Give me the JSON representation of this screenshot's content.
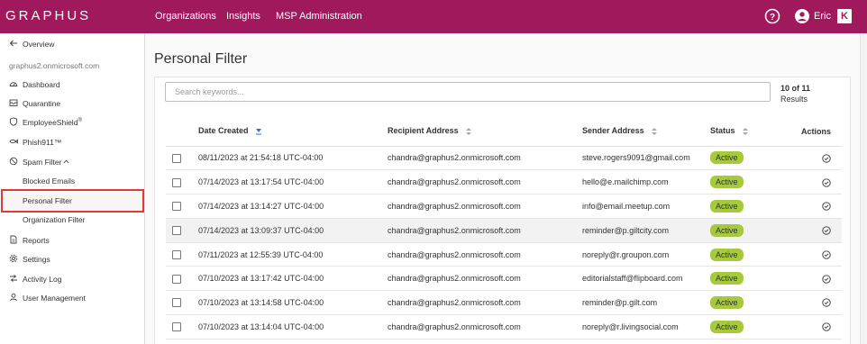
{
  "app": {
    "logo_text": "GRAPHUS"
  },
  "topnav": {
    "items": [
      "Organizations",
      "Insights",
      "MSP Administration"
    ]
  },
  "user": {
    "name": "Eric",
    "k_badge": "K"
  },
  "sidebar": {
    "overview_label": "Overview",
    "tenant": "graphus2.onmicrosoft.com",
    "items": {
      "dashboard": "Dashboard",
      "quarantine": "Quarantine",
      "employeeshield": "EmployeeShield",
      "employeeshield_mark": "®",
      "phish911": "Phish911™",
      "spam_filter": "Spam Filter",
      "blocked_emails": "Blocked Emails",
      "personal_filter": "Personal Filter",
      "organization_filter": "Organization Filter",
      "reports": "Reports",
      "settings": "Settings",
      "activity_log": "Activity Log",
      "user_management": "User Management"
    }
  },
  "main": {
    "title": "Personal Filter",
    "search_placeholder": "Search keywords...",
    "count_main": "10 of 11",
    "count_sub": "Results",
    "columns": {
      "date": "Date Created",
      "recipient": "Recipient Address",
      "sender": "Sender Address",
      "status": "Status",
      "actions": "Actions"
    },
    "rows": [
      {
        "date": "08/11/2023 at 21:54:18 UTC-04:00",
        "recipient": "chandra@graphus2.onmicrosoft.com",
        "sender": "steve.rogers9091@gmail.com",
        "status": "Active"
      },
      {
        "date": "07/14/2023 at 13:17:54 UTC-04:00",
        "recipient": "chandra@graphus2.onmicrosoft.com",
        "sender": "hello@e.mailchimp.com",
        "status": "Active"
      },
      {
        "date": "07/14/2023 at 13:14:27 UTC-04:00",
        "recipient": "chandra@graphus2.onmicrosoft.com",
        "sender": "info@email.meetup.com",
        "status": "Active"
      },
      {
        "date": "07/14/2023 at 13:09:37 UTC-04:00",
        "recipient": "chandra@graphus2.onmicrosoft.com",
        "sender": "reminder@p.giltcity.com",
        "status": "Active"
      },
      {
        "date": "07/11/2023 at 12:55:39 UTC-04:00",
        "recipient": "chandra@graphus2.onmicrosoft.com",
        "sender": "noreply@r.groupon.com",
        "status": "Active"
      },
      {
        "date": "07/10/2023 at 13:17:42 UTC-04:00",
        "recipient": "chandra@graphus2.onmicrosoft.com",
        "sender": "editorialstaff@flipboard.com",
        "status": "Active"
      },
      {
        "date": "07/10/2023 at 13:14:58 UTC-04:00",
        "recipient": "chandra@graphus2.onmicrosoft.com",
        "sender": "reminder@p.gilt.com",
        "status": "Active"
      },
      {
        "date": "07/10/2023 at 13:14:04 UTC-04:00",
        "recipient": "chandra@graphus2.onmicrosoft.com",
        "sender": "noreply@r.livingsocial.com",
        "status": "Active"
      }
    ]
  },
  "colors": {
    "brand": "#a0195c",
    "active_badge": "#a6c93d",
    "highlight": "#e23a3a"
  },
  "icons": [
    "help-icon",
    "user-avatar-icon",
    "k-app-icon",
    "arrow-left-icon",
    "dashboard-icon",
    "quarantine-icon",
    "shield-icon",
    "phish-icon",
    "spam-filter-icon",
    "chevron-up-icon",
    "reports-icon",
    "settings-icon",
    "activity-log-icon",
    "user-management-icon",
    "sort-icon",
    "check-circle-icon"
  ]
}
